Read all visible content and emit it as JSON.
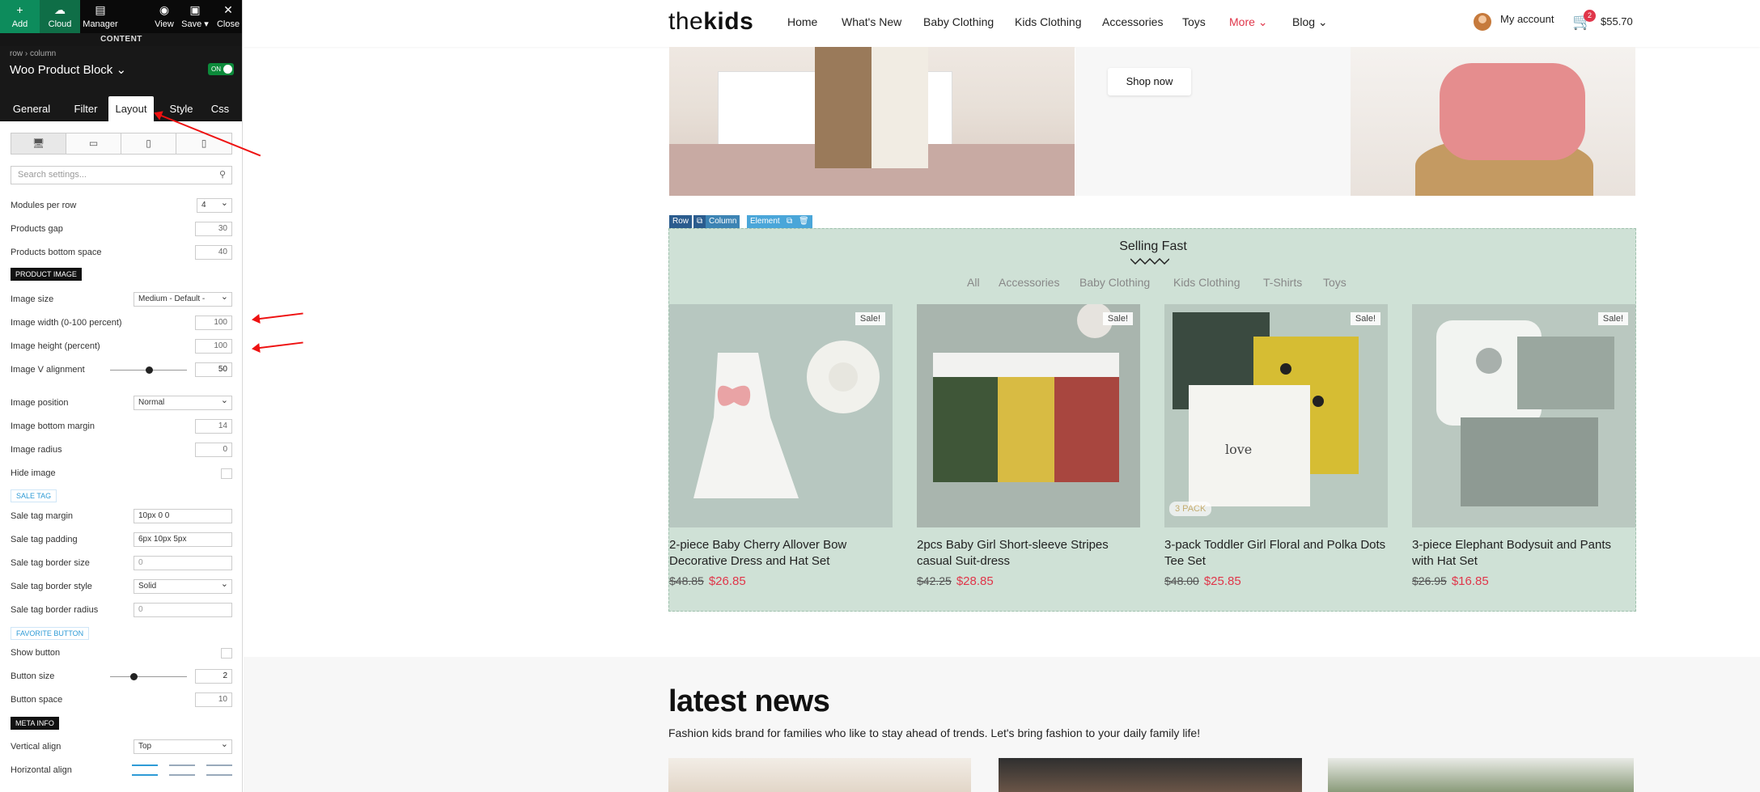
{
  "toolbar": {
    "add": "Add",
    "cloud": "Cloud",
    "manager": "Manager",
    "view": "View",
    "save": "Save ▾",
    "close": "Close",
    "content_label": "CONTENT"
  },
  "panel": {
    "breadcrumb": "row › column",
    "block_title": "Woo Product Block ⌄",
    "toggle_label": "ON",
    "tabs": [
      "General",
      "Filter",
      "Layout",
      "Style",
      "Css"
    ],
    "active_tab": "Layout",
    "search_placeholder": "Search settings...",
    "settings": {
      "modules_per_row": {
        "label": "Modules per row",
        "value": "4"
      },
      "products_gap": {
        "label": "Products gap",
        "value": "30"
      },
      "products_bottom_space": {
        "label": "Products bottom space",
        "value": "40"
      },
      "product_image_section": "PRODUCT IMAGE",
      "image_size": {
        "label": "Image size",
        "value": "Medium - Default -"
      },
      "image_width": {
        "label": "Image width (0-100 percent)",
        "value": "100"
      },
      "image_height": {
        "label": "Image height (percent)",
        "value": "100"
      },
      "image_v_alignment": {
        "label": "Image V alignment",
        "value": "50",
        "level": 0.5
      },
      "image_position": {
        "label": "Image position",
        "value": "Normal"
      },
      "image_bottom_margin": {
        "label": "Image bottom margin",
        "value": "14"
      },
      "image_radius": {
        "label": "Image radius",
        "value": "0"
      },
      "hide_image": {
        "label": "Hide image"
      },
      "sale_tag_section": "SALE TAG",
      "sale_tag_margin": {
        "label": "Sale tag margin",
        "value": "10px 0 0"
      },
      "sale_tag_padding": {
        "label": "Sale tag padding",
        "value": "6px 10px 5px"
      },
      "sale_tag_border_size": {
        "label": "Sale tag border size",
        "value": "0"
      },
      "sale_tag_border_style": {
        "label": "Sale tag border style",
        "value": "Solid"
      },
      "sale_tag_border_radius": {
        "label": "Sale tag border radius",
        "value": "0"
      },
      "favorite_section": "FAVORITE BUTTON",
      "show_button": {
        "label": "Show button"
      },
      "button_size": {
        "label": "Button size",
        "value": "2",
        "level": 0.3
      },
      "button_space": {
        "label": "Button space",
        "value": "10"
      },
      "meta_info_section": "META INFO",
      "vertical_align": {
        "label": "Vertical align",
        "value": "Top"
      },
      "horizontal_align": {
        "label": "Horizontal align"
      }
    }
  },
  "site": {
    "logo_light": "the",
    "logo_bold": "kids",
    "menu": [
      "Home",
      "What's New",
      "Baby Clothing",
      "Kids Clothing",
      "Accessories",
      "Toys",
      "More ⌄",
      "Blog ⌄"
    ],
    "account": "My account",
    "cart_count": "2",
    "cart_total": "$55.70",
    "shop_now": "Shop now",
    "vc_bar": [
      "Row",
      "⧉",
      "Column",
      "Element",
      "⧉",
      "🗑"
    ],
    "selling_title": "Selling Fast",
    "filters": [
      "All",
      "Accessories",
      "Baby Clothing",
      "Kids Clothing",
      "T-Shirts",
      "Toys"
    ],
    "sale_label": "Sale!",
    "pack_label": "3 PACK",
    "products": [
      {
        "name": "2-piece Baby Cherry Allover Bow Decorative Dress and Hat Set",
        "old": "$48.85",
        "new": "$26.85"
      },
      {
        "name": "2pcs Baby Girl Short-sleeve Stripes casual Suit-dress",
        "old": "$42.25",
        "new": "$28.85"
      },
      {
        "name": "3-pack Toddler Girl Floral and Polka Dots Tee Set",
        "old": "$48.00",
        "new": "$25.85"
      },
      {
        "name": "3-piece Elephant Bodysuit and Pants with Hat Set",
        "old": "$26.95",
        "new": "$16.85"
      }
    ],
    "news_title": "latest news",
    "news_subtitle": "Fashion kids brand for families who like to stay ahead of trends. Let's bring fashion to your daily family life!"
  },
  "colors": {
    "accent": "#e0364a",
    "selling_bg": "#cfe1d6",
    "toolbar_green": "#0d8c5c",
    "section_blue": "#2e9bd6"
  }
}
